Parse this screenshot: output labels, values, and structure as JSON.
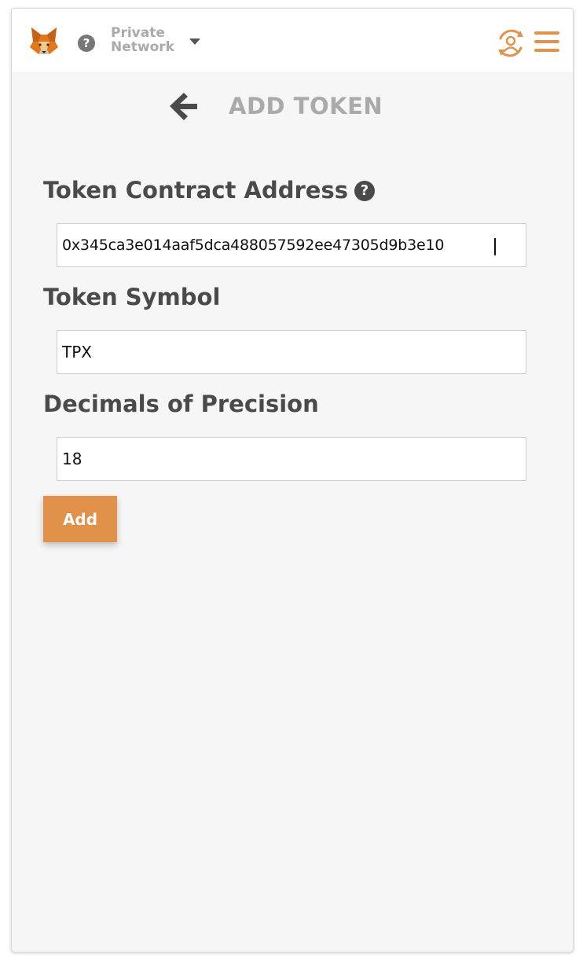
{
  "header": {
    "network_label": "Private Network",
    "icons": {
      "logo": "metamask-fox-icon",
      "help": "question-circle-icon",
      "dropdown": "caret-down-icon",
      "account": "account-switch-icon",
      "menu": "hamburger-menu-icon"
    },
    "help_glyph": "?"
  },
  "page": {
    "back_icon": "arrow-left-icon",
    "title": "ADD TOKEN"
  },
  "form": {
    "address_label": "Token Contract Address",
    "address_help_glyph": "?",
    "address_value": "0x345ca3e014aaf5dca488057592ee47305d9b3e10",
    "symbol_label": "Token Symbol",
    "symbol_value": "TPX",
    "decimals_label": "Decimals of Precision",
    "decimals_value": "18",
    "add_label": "Add"
  },
  "colors": {
    "accent": "#e2914a",
    "background": "#f6f6f6",
    "label_text": "#4a4a4a",
    "muted_text": "#aaaaaa"
  }
}
